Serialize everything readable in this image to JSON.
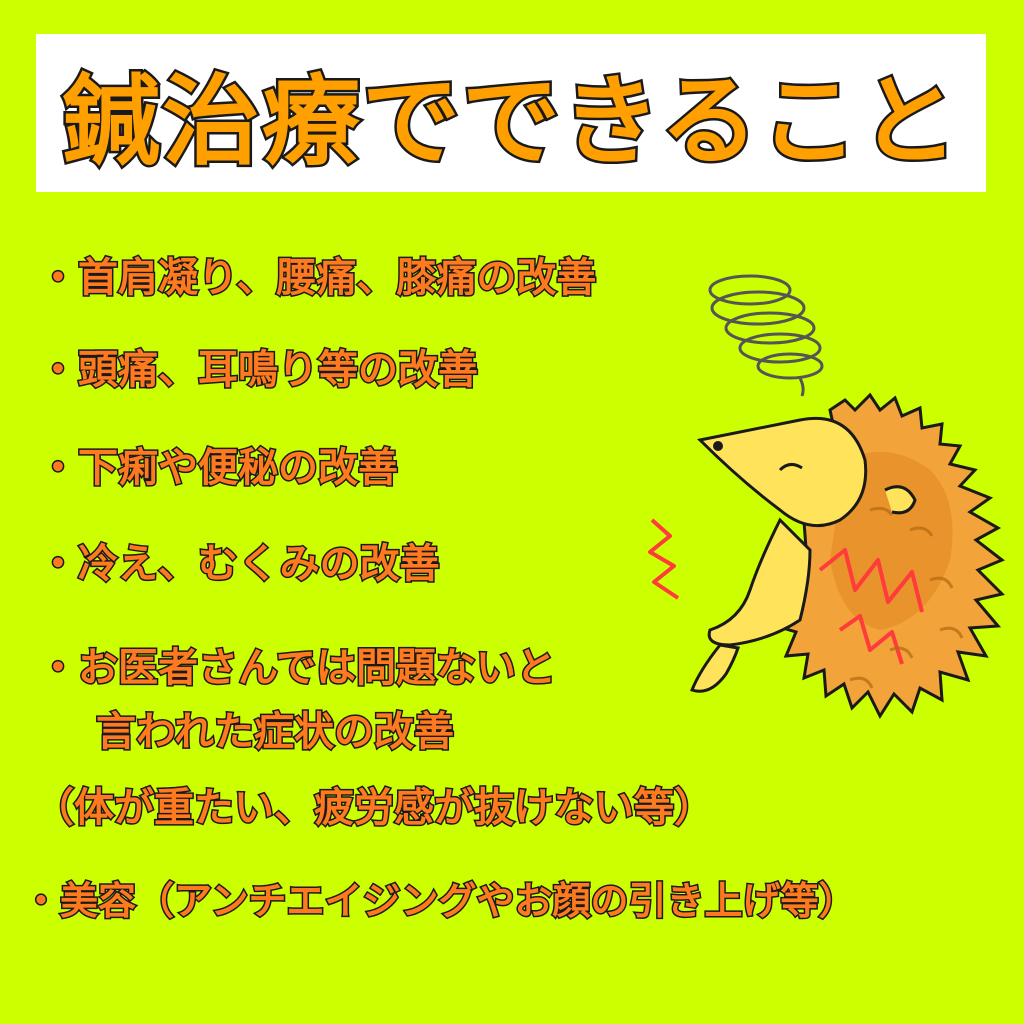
{
  "title": "鍼治療でできること",
  "items": {
    "item1": "・首肩凝り、腰痛、膝痛の改善",
    "item2": "・頭痛、耳鳴り等の改善",
    "item3": "・下痢や便秘の改善",
    "item4": "・冷え、むくみの改善",
    "item5_line1": "・お医者さんでは問題ないと",
    "item5_line2": "言われた症状の改善",
    "item5_line3": "（体が重たい、疲労感が抜けない等）",
    "item6": "・美容（アンチエイジングやお顔の引き上げ等）"
  },
  "colors": {
    "background": "#ccff00",
    "title_fill": "#ff9f00",
    "item_fill": "#ff7a1f",
    "outline": "#1a1a1a"
  },
  "illustration": "hedgehog-in-pain-icon"
}
